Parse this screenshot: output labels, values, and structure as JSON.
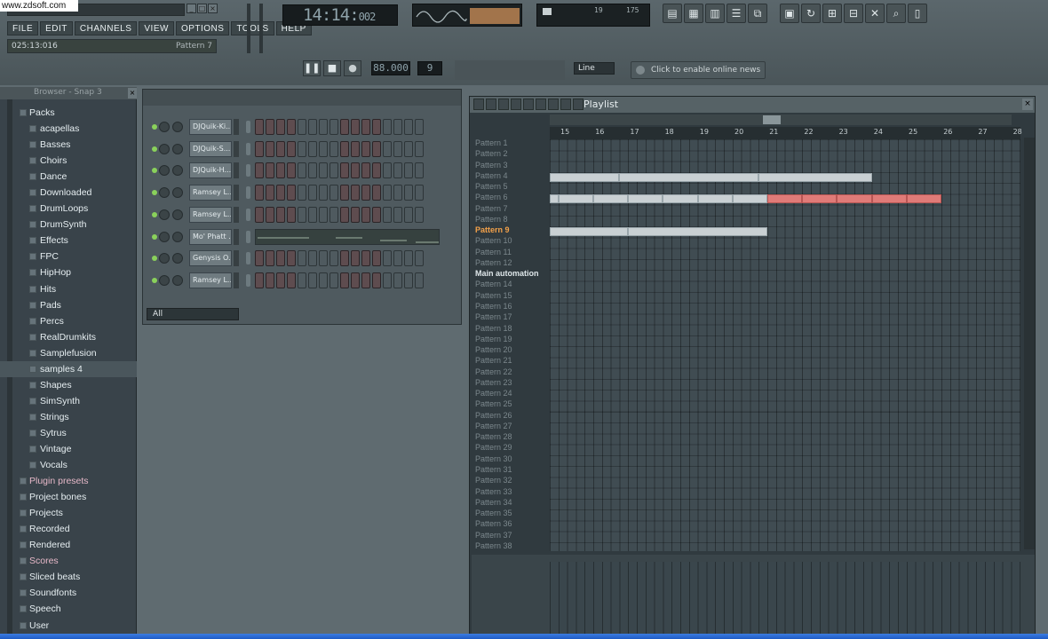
{
  "watermark": "www.zdsoft.com",
  "menu": [
    "FILE",
    "EDIT",
    "CHANNELS",
    "VIEW",
    "OPTIONS",
    "TOOLS",
    "HELP"
  ],
  "hint": {
    "time": "025:13:016",
    "pattern": "Pattern 7"
  },
  "clock": {
    "main": "14:14:",
    "ms": "002"
  },
  "cpu": {
    "a": "19",
    "b": "175"
  },
  "transport": {
    "pause": "❚❚",
    "stop": "■",
    "record": "●"
  },
  "tempo": "88.000",
  "pattern_number": "9",
  "snap": "Line",
  "news": "Click to enable online news",
  "toolbar_icons": [
    "mixer",
    "playlist",
    "piano-roll",
    "browser",
    "plugin",
    "channel",
    "undo",
    "save",
    "export",
    "render",
    "search",
    "file",
    "help"
  ],
  "browser": {
    "title": "Browser - Snap 3",
    "items": [
      {
        "label": "Packs",
        "type": "top",
        "sel": false
      },
      {
        "label": "acapellas",
        "type": "sub",
        "sel": false
      },
      {
        "label": "Basses",
        "type": "sub",
        "sel": false
      },
      {
        "label": "Choirs",
        "type": "sub",
        "sel": false
      },
      {
        "label": "Dance",
        "type": "sub",
        "sel": false
      },
      {
        "label": "Downloaded",
        "type": "sub",
        "sel": false
      },
      {
        "label": "DrumLoops",
        "type": "sub",
        "sel": false
      },
      {
        "label": "DrumSynth",
        "type": "sub",
        "sel": false
      },
      {
        "label": "Effects",
        "type": "sub",
        "sel": false
      },
      {
        "label": "FPC",
        "type": "sub",
        "sel": false
      },
      {
        "label": "HipHop",
        "type": "sub",
        "sel": false
      },
      {
        "label": "Hits",
        "type": "sub",
        "sel": false
      },
      {
        "label": "Pads",
        "type": "sub",
        "sel": false
      },
      {
        "label": "Percs",
        "type": "sub",
        "sel": false
      },
      {
        "label": "RealDrumkits",
        "type": "sub",
        "sel": false
      },
      {
        "label": "Samplefusion",
        "type": "sub",
        "sel": false
      },
      {
        "label": "samples 4",
        "type": "sub",
        "sel": true
      },
      {
        "label": "Shapes",
        "type": "sub",
        "sel": false
      },
      {
        "label": "SimSynth",
        "type": "sub",
        "sel": false
      },
      {
        "label": "Strings",
        "type": "sub",
        "sel": false
      },
      {
        "label": "Sytrus",
        "type": "sub",
        "sel": false
      },
      {
        "label": "Vintage",
        "type": "sub",
        "sel": false
      },
      {
        "label": "Vocals",
        "type": "sub",
        "sel": false
      },
      {
        "label": "Plugin presets",
        "type": "top",
        "pink": true
      },
      {
        "label": "Project bones",
        "type": "top"
      },
      {
        "label": "Projects",
        "type": "top"
      },
      {
        "label": "Recorded",
        "type": "top"
      },
      {
        "label": "Rendered",
        "type": "top"
      },
      {
        "label": "Scores",
        "type": "top",
        "pink": true
      },
      {
        "label": "Sliced beats",
        "type": "top"
      },
      {
        "label": "Soundfonts",
        "type": "top"
      },
      {
        "label": "Speech",
        "type": "top"
      },
      {
        "label": "User",
        "type": "top"
      }
    ]
  },
  "stepseq": {
    "filter": "All",
    "channels": [
      {
        "name": "DJQuik-Ki...",
        "graph": false
      },
      {
        "name": "DJQuik-S...",
        "graph": false
      },
      {
        "name": "DJQuik-H...",
        "graph": false
      },
      {
        "name": "Ramsey L...",
        "graph": false
      },
      {
        "name": "Ramsey L...",
        "graph": false
      },
      {
        "name": "Mo' Phatt ...",
        "graph": true
      },
      {
        "name": "Genysis O...",
        "graph": false
      },
      {
        "name": "Ramsey L...",
        "graph": false
      }
    ]
  },
  "playlist": {
    "title": "Playlist",
    "ruler": [
      "15",
      "16",
      "17",
      "18",
      "19",
      "20",
      "21",
      "22",
      "23",
      "24",
      "25",
      "26",
      "27",
      "28"
    ],
    "rows": [
      "Pattern 1",
      "Pattern 2",
      "Pattern 3",
      "Pattern 4",
      "Pattern 5",
      "Pattern 6",
      "Pattern 7",
      "Pattern 8",
      "Pattern 9",
      "Pattern 10",
      "Pattern 11",
      "Pattern 12",
      "Main automation",
      "Pattern 14",
      "Pattern 15",
      "Pattern 16",
      "Pattern 17",
      "Pattern 18",
      "Pattern 19",
      "Pattern 20",
      "Pattern 21",
      "Pattern 22",
      "Pattern 23",
      "Pattern 24",
      "Pattern 25",
      "Pattern 26",
      "Pattern 27",
      "Pattern 28",
      "Pattern 29",
      "Pattern 30",
      "Pattern 31",
      "Pattern 32",
      "Pattern 33",
      "Pattern 34",
      "Pattern 35",
      "Pattern 36",
      "Pattern 37",
      "Pattern 38"
    ],
    "active_row": 8,
    "automation_row": 12,
    "clips": [
      {
        "row": 3,
        "start": 0,
        "len": 8,
        "color": "grey"
      },
      {
        "row": 3,
        "start": 8,
        "len": 16,
        "color": "grey"
      },
      {
        "row": 3,
        "start": 24,
        "len": 13,
        "color": "grey"
      },
      {
        "row": 5,
        "start": 0,
        "len": 1,
        "color": "grey"
      },
      {
        "row": 5,
        "start": 1,
        "len": 4,
        "color": "grey"
      },
      {
        "row": 5,
        "start": 5,
        "len": 4,
        "color": "grey"
      },
      {
        "row": 5,
        "start": 9,
        "len": 4,
        "color": "grey"
      },
      {
        "row": 5,
        "start": 13,
        "len": 4,
        "color": "grey"
      },
      {
        "row": 5,
        "start": 17,
        "len": 4,
        "color": "grey"
      },
      {
        "row": 5,
        "start": 21,
        "len": 4,
        "color": "grey"
      },
      {
        "row": 5,
        "start": 25,
        "len": 4,
        "color": "red"
      },
      {
        "row": 5,
        "start": 29,
        "len": 4,
        "color": "red"
      },
      {
        "row": 5,
        "start": 33,
        "len": 4,
        "color": "red"
      },
      {
        "row": 5,
        "start": 37,
        "len": 4,
        "color": "red"
      },
      {
        "row": 5,
        "start": 41,
        "len": 4,
        "color": "red"
      },
      {
        "row": 8,
        "start": 0,
        "len": 9,
        "color": "grey"
      },
      {
        "row": 8,
        "start": 9,
        "len": 16,
        "color": "grey"
      }
    ]
  }
}
